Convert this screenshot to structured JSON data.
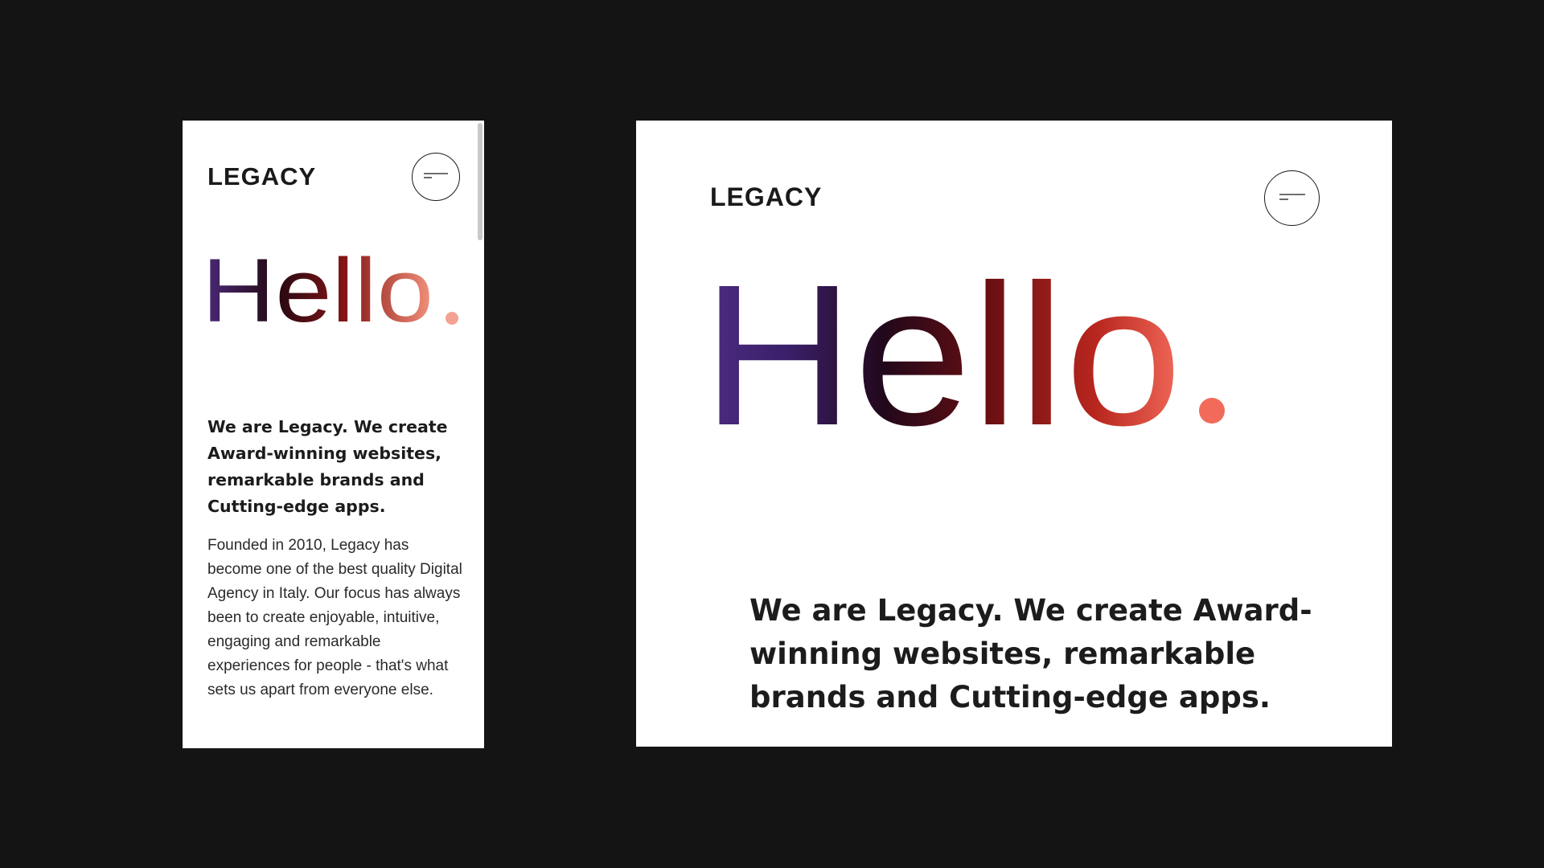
{
  "mobile": {
    "logo": "LEGACY",
    "hello": "Hello",
    "dot": ".",
    "headline": "We are Legacy. We create Award-winning websites, remarkable brands and Cutting-edge apps.",
    "body": "Founded in 2010, Legacy has become one of the best quality Digital Agency in Italy. Our focus has always been to create enjoyable, intuitive, engaging and remarkable experiences for people - that's what sets us apart from everyone else.",
    "menu_icon": "menu-icon"
  },
  "desktop": {
    "logo": "LEGACY",
    "hello": "Hello",
    "dot": ".",
    "headline": "We are Legacy. We create Award-winning websites, remarkable brands and Cutting-edge apps.",
    "menu_icon": "menu-icon"
  },
  "colors": {
    "background": "#141414",
    "panel": "#ffffff",
    "gradient_start": "#4a2a7a",
    "gradient_mid": "#2a0b10",
    "gradient_red": "#8a1414",
    "gradient_end": "#f26a5a",
    "text": "#1c1c1c"
  }
}
